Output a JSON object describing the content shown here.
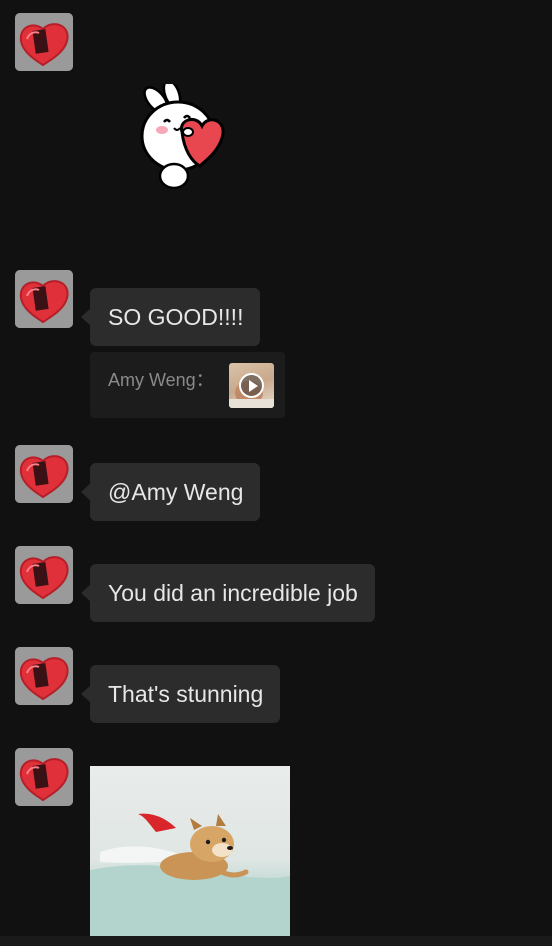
{
  "messages": [
    {
      "type": "sticker",
      "sticker": "bunny-heart-sticker"
    },
    {
      "type": "text",
      "text": "SO GOOD!!!!"
    },
    {
      "type": "quote",
      "label": "Amy Weng："
    },
    {
      "type": "text",
      "text": "@Amy Weng"
    },
    {
      "type": "text",
      "text": "You did an incredible job"
    },
    {
      "type": "text",
      "text": "That's stunning"
    },
    {
      "type": "sticker",
      "sticker": "flying-dog-sticker"
    }
  ],
  "colors": {
    "background": "#111111",
    "bubble": "#2c2c2c",
    "bubble_text": "#e7e7e7",
    "quote_bg": "#1c1c1c",
    "quote_text": "#8a8a8a",
    "avatar_heart": "#e0303a"
  }
}
